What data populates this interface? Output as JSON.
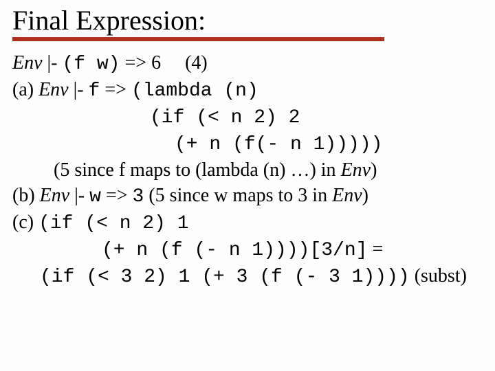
{
  "title": "Final Expression:",
  "ln1_env": "Env",
  "ln1_turnstile": " |- ",
  "ln1_expr": "(f w)",
  "ln1_arrow": " => ",
  "ln1_res": "6",
  "ln1_rule": "(4)",
  "ln2_pre": "(a) ",
  "ln2_env": "Env",
  "ln2_turnstile": " |- ",
  "ln2_f": "f",
  "ln2_arrow": " => ",
  "ln2_code": "(lambda (n)",
  "ln3_code": "(if (< n 2) 2",
  "ln4_code": "(+ n (f(- n 1)))))",
  "ln5_open": "(5 since f maps to (lambda (n) …) in ",
  "ln5_env": "Env",
  "ln5_close": ")",
  "ln6_pre": "(b) ",
  "ln6_env": "Env",
  "ln6_turnstile": " |- ",
  "ln6_w": "w",
  "ln6_arrow": " => ",
  "ln6_val": "3",
  "ln6_reason_a": "  (5 since w maps to 3 in ",
  "ln6_env2": "Env",
  "ln6_reason_b": ")",
  "ln7_pre": "(c) ",
  "ln7_code": "(if (< n 2) 1",
  "ln8_code": "(+ n (f (- n 1))))",
  "ln8_sub": "[3/n]",
  "ln8_eq": " =",
  "ln9_code": "(if (< 3 2) 1 (+ 3 (f (- 3 1))))",
  "ln9_reason": " (subst)"
}
